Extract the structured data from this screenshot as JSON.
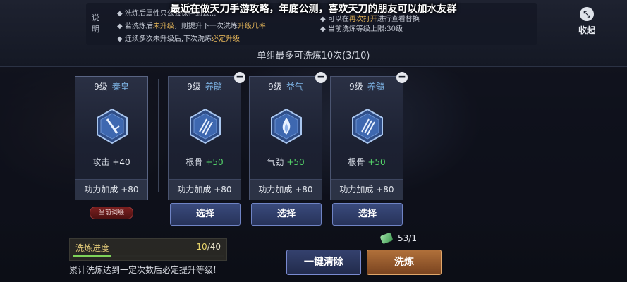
{
  "overlay_caption": "最近在做天刀手游攻略，年底公测，喜欢天刀的朋友可以加水友群",
  "notes": {
    "label": "说明",
    "line1": "洗炼后属性只公会保存到公...",
    "line2_pre": "若洗炼后",
    "line2_hl1": "未升级",
    "line2_mid": "，则提升下一次洗炼",
    "line2_hl2": "升级几率",
    "line3_pre": "连续多次未升级后,下次洗炼",
    "line3_hl": "必定升级",
    "line4_pre": "可以在",
    "line4_hl": "再次打开",
    "line4_post": "进行查看替换",
    "line5": "当前洗炼等级上限:30级"
  },
  "collapse": {
    "icon": "collapse-arrows-icon",
    "label": "收起"
  },
  "subtitle": "单组最多可洗炼10次(3/10)",
  "current": {
    "level": "9级",
    "name": "秦皇",
    "stat_name": "攻击",
    "stat_value": "+40",
    "bonus": "功力加成 +80",
    "badge": "当前词缀"
  },
  "options": [
    {
      "level": "9级",
      "name": "养髓",
      "stat_name": "根骨",
      "stat_value": "+50",
      "bonus": "功力加成 +80",
      "select": "选择"
    },
    {
      "level": "9级",
      "name": "益气",
      "stat_name": "气劲",
      "stat_value": "+50",
      "bonus": "功力加成 +80",
      "select": "选择"
    },
    {
      "level": "9级",
      "name": "养髓",
      "stat_name": "根骨",
      "stat_value": "+50",
      "bonus": "功力加成 +80",
      "select": "选择"
    }
  ],
  "progress": {
    "label": "洗炼进度",
    "current": "10",
    "total": "/40",
    "fraction": 0.25
  },
  "hint": "累计洗炼达到一定次数后必定提升等级!",
  "currency": {
    "icon": "jade-gem-icon",
    "value": "53/1"
  },
  "buttons": {
    "clear": "一键清除",
    "refine": "洗炼"
  },
  "colors": {
    "accent_green": "#55d66a",
    "gold": "#e8b85a",
    "select_blue": "#3a4a7c",
    "refine_orange": "#b0703a"
  }
}
